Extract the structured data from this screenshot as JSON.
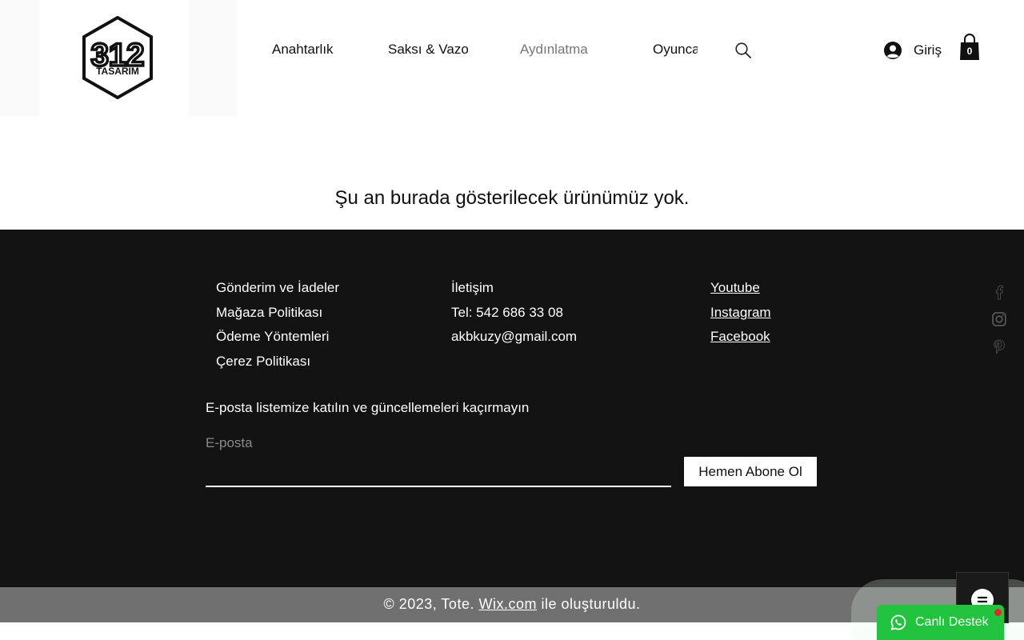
{
  "brand": {
    "logo_line1": "312",
    "logo_line2": "TASARIM"
  },
  "nav": {
    "items": [
      {
        "label": "Anahtarlık"
      },
      {
        "label": "Saksı & Vazo"
      },
      {
        "label": "Aydınlatma",
        "active": true
      },
      {
        "label": "Oyunca"
      }
    ]
  },
  "header": {
    "login_label": "Giriş",
    "cart_count": "0",
    "search_icon": "search-icon",
    "cart_icon": "shopping-bag-icon"
  },
  "main": {
    "empty_message": "Şu an burada gösterilecek ürünümüz yok."
  },
  "footer": {
    "policies": [
      "Gönderim ve İadeler",
      "Mağaza Politikası",
      "Ödeme  Yöntemleri",
      "Çerez Politikası"
    ],
    "contact": {
      "title": "İletişim",
      "phone": "Tel: 542 686 33 08",
      "email": "akbkuzy@gmail.com"
    },
    "social_links": [
      "Youtube",
      "Instagram",
      "Facebook"
    ],
    "social_icons": [
      "facebook-icon",
      "instagram-icon",
      "pinterest-icon"
    ],
    "newsletter": {
      "title": "E-posta listemize katılın ve güncellemeleri kaçırmayın",
      "email_label": "E-posta",
      "subscribe_label": "Hemen Abone Ol"
    },
    "copyright": {
      "prefix": "© 2023, Tote. ",
      "link": "Wix.com",
      "suffix": " ile oluşturuldu."
    }
  },
  "widgets": {
    "support_label": "Canlı Destek"
  },
  "colors": {
    "footer_bg": "#131313",
    "copyright_bg": "#707070",
    "support_green": "#22c33e",
    "alert_red": "#e8252a"
  }
}
